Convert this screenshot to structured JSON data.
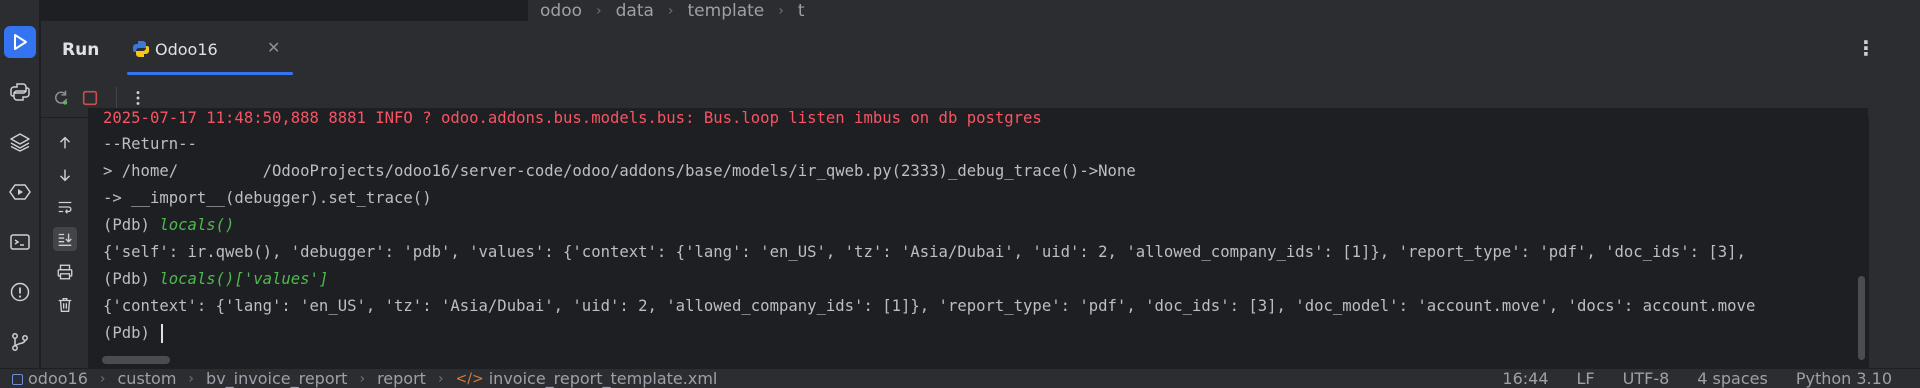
{
  "breadcrumb_top": [
    "odoo",
    "data",
    "template",
    "t"
  ],
  "run_panel": {
    "title": "Run",
    "tab_label": "Odoo16"
  },
  "console": {
    "lines": [
      {
        "text": "2025-07-17 11:48:50,888 8881 INFO ? odoo.addons.bus.models.bus: Bus.loop listen imbus on db postgres",
        "type": "err"
      },
      {
        "text": "--Return--",
        "type": "out"
      },
      {
        "text": "> /home/         /OdooProjects/odoo16/server-code/odoo/addons/base/models/ir_qweb.py(2333)_debug_trace()->None",
        "type": "out"
      },
      {
        "text": "-> __import__(debugger).set_trace()",
        "type": "out"
      },
      {
        "prompt": "(Pdb) ",
        "cmd": "locals()",
        "type": "cmd"
      },
      {
        "text": "{'self': ir.qweb(), 'debugger': 'pdb', 'values': {'context': {'lang': 'en_US', 'tz': 'Asia/Dubai', 'uid': 2, 'allowed_company_ids': [1]}, 'report_type': 'pdf', 'doc_ids': [3],",
        "type": "out"
      },
      {
        "prompt": "(Pdb) ",
        "cmd": "locals()['values']",
        "type": "cmd"
      },
      {
        "text": "{'context': {'lang': 'en_US', 'tz': 'Asia/Dubai', 'uid': 2, 'allowed_company_ids': [1]}, 'report_type': 'pdf', 'doc_ids': [3], 'doc_model': 'account.move', 'docs': account.move",
        "type": "out"
      },
      {
        "prompt": "(Pdb) ",
        "cmd": "",
        "type": "input"
      }
    ]
  },
  "status_bar": {
    "crumbs": [
      "odoo16",
      "custom",
      "bv_invoice_report",
      "report",
      "invoice_report_template.xml"
    ],
    "position": "16:44",
    "line_ending": "LF",
    "encoding": "UTF-8",
    "indent": "4 spaces",
    "interpreter": "Python 3.10"
  },
  "colors": {
    "accent": "#3574f0",
    "error_text": "#f75464",
    "command_text": "#4eb94e",
    "stop": "#c94f4f"
  },
  "icons": {
    "activity": [
      "run-icon",
      "python-icon",
      "layers-icon",
      "services-icon",
      "terminal-icon",
      "problems-icon",
      "git-icon"
    ],
    "toolbar": [
      "rerun-icon",
      "stop-icon",
      "more-icon"
    ],
    "side": [
      "scroll-up-icon",
      "scroll-down-icon",
      "soft-wrap-icon",
      "scroll-to-end-icon",
      "print-icon",
      "trash-icon"
    ]
  }
}
